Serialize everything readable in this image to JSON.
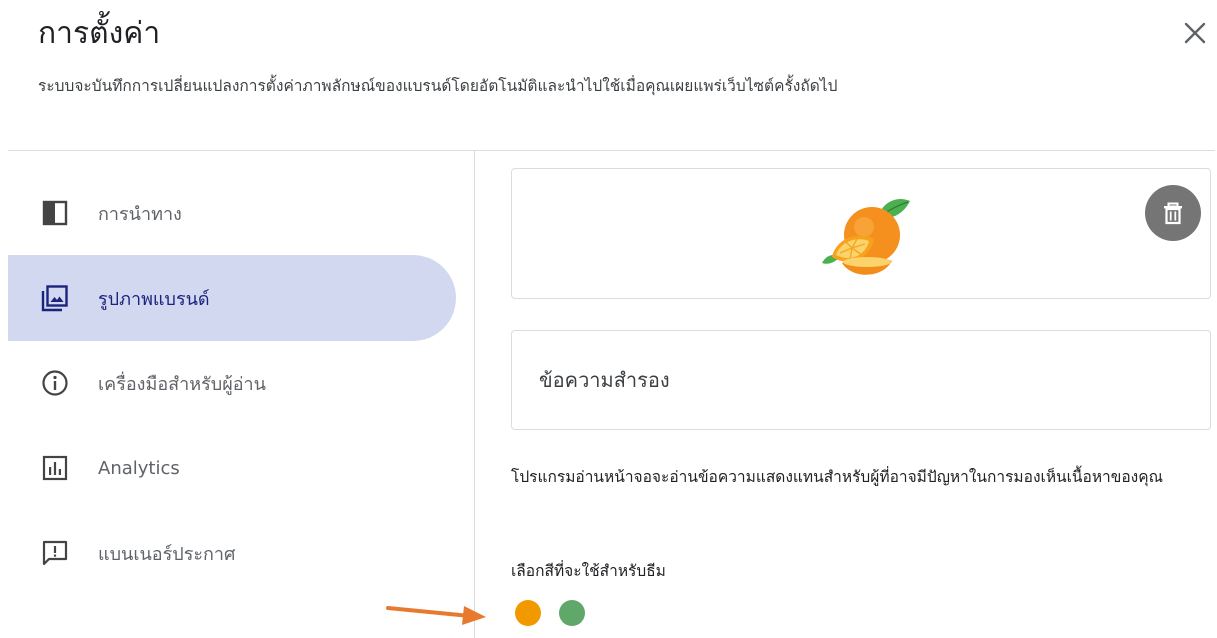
{
  "dialog": {
    "title": "การตั้งค่า",
    "subtitle": "ระบบจะบันทึกการเปลี่ยนแปลงการตั้งค่าภาพลักษณ์ของแบรนด์โดยอัตโนมัติและนำไปใช้เมื่อคุณเผยแพร่เว็บไซต์ครั้งถัดไป",
    "close_icon": "close-icon"
  },
  "sidebar": {
    "items": [
      {
        "label": "การนำทาง",
        "icon": "navigation-panel-icon",
        "active": false
      },
      {
        "label": "รูปภาพแบรนด์",
        "icon": "brand-images-icon",
        "active": true
      },
      {
        "label": "เครื่องมือสำหรับผู้อ่าน",
        "icon": "info-icon",
        "active": false
      },
      {
        "label": "Analytics",
        "icon": "analytics-icon",
        "active": false
      },
      {
        "label": "แบนเนอร์ประกาศ",
        "icon": "announcement-icon",
        "active": false
      }
    ]
  },
  "main": {
    "brand_image": {
      "icon": "orange-fruit-image",
      "delete_icon": "trash-icon"
    },
    "alt_text": {
      "placeholder": "ข้อความสำรอง",
      "value": ""
    },
    "helper_text": "โปรแกรมอ่านหน้าจอจะอ่านข้อความแสดงแทนสำหรับผู้ที่อาจมีปัญหาในการมองเห็นเนื้อหาของคุณ",
    "theme_label": "เลือกสีที่จะใช้สำหรับธีม",
    "theme_colors": [
      {
        "name": "orange",
        "hex": "#f29900"
      },
      {
        "name": "green",
        "hex": "#5fa86a"
      }
    ]
  },
  "colors": {
    "active_nav_bg": "#d2d8f0",
    "active_nav_text": "#1a237e",
    "annotation_arrow": "#e87a2e"
  }
}
